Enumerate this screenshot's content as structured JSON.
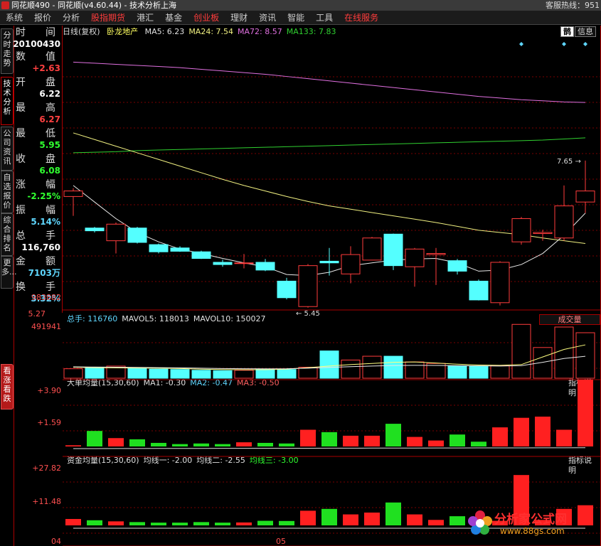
{
  "app": {
    "title": "同花顺490 - 同花顺(v4.60.44) - 技术分析上海",
    "title_right": "客服热线：951"
  },
  "menu": [
    "系统",
    "报价",
    "分析",
    "股指期货",
    "港汇",
    "基金",
    "创业板",
    "理财",
    "资讯",
    "智能",
    "工具",
    "在线服务"
  ],
  "menu_red": [
    false,
    false,
    false,
    true,
    false,
    false,
    true,
    false,
    false,
    false,
    false,
    true
  ],
  "left_tabs": [
    "分时走势",
    "技术分析",
    "公司资讯",
    "自选报价",
    "综合排名",
    "更多..."
  ],
  "left_tab_bottom": "看涨看跌",
  "info": {
    "time_label": "时　　间",
    "time_value": "20100430",
    "rows": [
      {
        "label": "数　　值",
        "value": "+2.63",
        "color": "#ff4040"
      },
      {
        "label": "开　　盘",
        "value": "6.22",
        "color": "#ffffff"
      },
      {
        "label": "最　　高",
        "value": "6.27",
        "color": "#ff4040"
      },
      {
        "label": "最　　低",
        "value": "5.95",
        "color": "#30ff30"
      },
      {
        "label": "收　　盘",
        "value": "6.08",
        "color": "#30ff30"
      },
      {
        "label": "涨　　幅",
        "value": "-2.25%",
        "color": "#30ff30"
      },
      {
        "label": "振　　幅",
        "value": "5.14%",
        "color": "#5fd7ff"
      },
      {
        "label": "总　　手",
        "value": "116,760",
        "color": "#ffffff"
      },
      {
        "label": "金　　额",
        "value": "7103万",
        "color": "#5fd7ff"
      },
      {
        "label": "换　　手",
        "value": "3.32%",
        "color": "#5fd7ff"
      }
    ]
  },
  "price_panel": {
    "prefix": "日线(复权)",
    "stock_name": "卧龙地产",
    "ma_labels": [
      {
        "text": "MA5: 6.23",
        "color": "#e0e0e0"
      },
      {
        "text": "MA24: 7.54",
        "color": "#f0f080"
      },
      {
        "text": "MA72: 8.57",
        "color": "#e070e0"
      },
      {
        "text": "MA133: 7.83",
        "color": "#30d030"
      }
    ],
    "btn_small": "鹊",
    "btn_info": "信息",
    "high_annot": "7.65",
    "low_annot": "5.45",
    "bottom_axis_label": "5.27",
    "colors": {
      "up": "#ff3c3c",
      "down": "#54ffff",
      "ma5": "#e8e8e8",
      "ma24": "#f0f080",
      "ma72": "#e070e0",
      "ma133": "#30d030"
    }
  },
  "volume_panel": {
    "labels": [
      {
        "text": "总手: 116760",
        "color": "#5fd7ff"
      },
      {
        "text": "MAVOL5: 118013",
        "color": "#e0e0e0"
      },
      {
        "text": "MAVOL10: 150027",
        "color": "#e0e0e0"
      }
    ],
    "button": "成交量",
    "axis": [
      "983882",
      "491941"
    ]
  },
  "bigorder_panel": {
    "labels": [
      {
        "text": "大单均量(15,30,60)",
        "color": "#e0e0e0"
      },
      {
        "text": "MA1: -0.30",
        "color": "#e0e0e0"
      },
      {
        "text": "MA2: -0.47",
        "color": "#5fd7ff"
      },
      {
        "text": "MA3: -0.50",
        "color": "#ff6060"
      }
    ],
    "button": "指标说明",
    "axis": [
      "+3.90",
      "+1.59"
    ]
  },
  "fund_panel": {
    "labels": [
      {
        "text": "资金均量(15,30,60)",
        "color": "#e0e0e0"
      },
      {
        "text": "均线一: -2.00",
        "color": "#e0e0e0"
      },
      {
        "text": "均线二: -2.55",
        "color": "#e0e0e0"
      },
      {
        "text": "均线三: -3.00",
        "color": "#30ff30"
      }
    ],
    "button": "指标说明",
    "axis": [
      "+27.82",
      "+11.48",
      "04"
    ],
    "date_label": "05"
  },
  "watermark": {
    "text": "分析家公式网",
    "url": "www.88gs.com"
  },
  "chart_data": {
    "type": "candlestick",
    "price_ylim": [
      5.27,
      9.5
    ],
    "candles": [
      {
        "o": 6.85,
        "c": 6.95,
        "h": 7.0,
        "l": 6.5
      },
      {
        "o": 6.28,
        "c": 6.23,
        "h": 6.3,
        "l": 6.2
      },
      {
        "o": 6.05,
        "c": 6.35,
        "h": 6.38,
        "l": 5.82
      },
      {
        "o": 6.28,
        "c": 6.02,
        "h": 6.3,
        "l": 6.0
      },
      {
        "o": 5.98,
        "c": 5.85,
        "h": 6.0,
        "l": 5.82
      },
      {
        "o": 5.92,
        "c": 5.86,
        "h": 5.95,
        "l": 5.85
      },
      {
        "o": 5.85,
        "c": 5.73,
        "h": 5.87,
        "l": 5.72
      },
      {
        "o": 5.66,
        "c": 5.62,
        "h": 5.71,
        "l": 5.58
      },
      {
        "o": 5.65,
        "c": 5.65,
        "h": 5.81,
        "l": 5.55
      },
      {
        "o": 5.66,
        "c": 5.52,
        "h": 5.72,
        "l": 5.5
      },
      {
        "o": 5.32,
        "c": 5.02,
        "h": 5.38,
        "l": 4.99
      },
      {
        "o": 4.86,
        "c": 5.6,
        "h": 5.63,
        "l": 4.84
      },
      {
        "o": 5.68,
        "c": 5.65,
        "h": 5.92,
        "l": 5.42
      },
      {
        "o": 5.45,
        "c": 5.8,
        "h": 5.95,
        "l": 5.28
      },
      {
        "o": 5.7,
        "c": 6.1,
        "h": 6.12,
        "l": 5.7
      },
      {
        "o": 6.17,
        "c": 5.6,
        "h": 6.18,
        "l": 5.52
      },
      {
        "o": 5.58,
        "c": 5.9,
        "h": 5.92,
        "l": 5.22
      },
      {
        "o": 5.8,
        "c": 5.82,
        "h": 5.92,
        "l": 5.25
      },
      {
        "o": 5.69,
        "c": 5.5,
        "h": 5.72,
        "l": 5.44
      },
      {
        "o": 5.32,
        "c": 4.98,
        "h": 5.35,
        "l": 4.97
      },
      {
        "o": 4.93,
        "c": 5.66,
        "h": 5.68,
        "l": 4.88
      },
      {
        "o": 6.03,
        "c": 6.45,
        "h": 6.48,
        "l": 5.98
      },
      {
        "o": 6.18,
        "c": 6.2,
        "h": 6.25,
        "l": 6.05
      },
      {
        "o": 6.1,
        "c": 6.68,
        "h": 7.05,
        "l": 6.05
      },
      {
        "o": 6.75,
        "c": 6.95,
        "h": 7.5,
        "l": 6.55
      }
    ],
    "ma5": [
      7.05,
      6.75,
      6.45,
      6.2,
      6.03,
      5.9,
      5.82,
      5.73,
      5.65,
      5.58,
      5.44,
      5.42,
      5.48,
      5.6,
      5.65,
      5.7,
      5.72,
      5.73,
      5.65,
      5.5,
      5.52,
      5.62,
      5.82,
      6.15,
      6.55
    ],
    "ma24": [
      8.0,
      7.88,
      7.76,
      7.64,
      7.52,
      7.4,
      7.28,
      7.16,
      7.05,
      6.95,
      6.85,
      6.76,
      6.68,
      6.62,
      6.56,
      6.5,
      6.44,
      6.38,
      6.31,
      6.24,
      6.2,
      6.16,
      6.1,
      6.05,
      6.0
    ],
    "ma72": [
      9.28,
      9.26,
      9.24,
      9.22,
      9.2,
      9.18,
      9.15,
      9.12,
      9.09,
      9.06,
      9.02,
      8.98,
      8.94,
      8.9,
      8.86,
      8.82,
      8.78,
      8.74,
      8.7,
      8.66,
      8.63,
      8.6,
      8.58,
      8.56,
      8.55
    ],
    "ma133": [
      7.64,
      7.65,
      7.66,
      7.68,
      7.69,
      7.7,
      7.71,
      7.72,
      7.73,
      7.74,
      7.75,
      7.76,
      7.77,
      7.78,
      7.79,
      7.8,
      7.81,
      7.82,
      7.83,
      7.84,
      7.85,
      7.86,
      7.87,
      7.89,
      7.91
    ],
    "volume": [
      250000,
      280000,
      320000,
      260000,
      240000,
      230000,
      210000,
      200000,
      210000,
      240000,
      230000,
      290000,
      720000,
      480000,
      580000,
      580000,
      430000,
      390000,
      330000,
      310000,
      330000,
      1420000,
      810000,
      1350000,
      1200000
    ],
    "volume_ylim": [
      0,
      1500000
    ],
    "mavol5": [
      290000,
      280000,
      275000,
      270000,
      265000,
      255000,
      240000,
      230000,
      225000,
      225000,
      240000,
      280000,
      320000,
      360000,
      390000,
      420000,
      430000,
      400000,
      370000,
      350000,
      340000,
      360000,
      560000,
      760000,
      880000
    ],
    "mavol10": [
      300000,
      295000,
      290000,
      285000,
      280000,
      275000,
      265000,
      255000,
      250000,
      248000,
      250000,
      265000,
      285000,
      305000,
      320000,
      335000,
      340000,
      338000,
      330000,
      325000,
      320000,
      330000,
      420000,
      520000,
      580000
    ],
    "bigorder": [
      0.1,
      1.3,
      0.7,
      0.6,
      0.3,
      0.2,
      0.25,
      0.2,
      0.35,
      0.3,
      0.25,
      1.4,
      1.2,
      0.9,
      0.9,
      1.9,
      0.8,
      0.5,
      1.0,
      0.4,
      1.6,
      2.4,
      2.5,
      1.4,
      5.6
    ],
    "bigorder_ylim": [
      -0.3,
      5.0
    ],
    "fund": [
      3.5,
      2.8,
      2.2,
      1.8,
      1.5,
      1.5,
      1.8,
      1.5,
      1.6,
      2.5,
      2.4,
      8.0,
      9.0,
      6.0,
      7.0,
      12.5,
      6.0,
      3.0,
      5.0,
      1.5,
      2.5,
      27.5,
      3.0,
      9.0,
      11.0
    ],
    "fund_ylim": [
      -2,
      33
    ]
  }
}
